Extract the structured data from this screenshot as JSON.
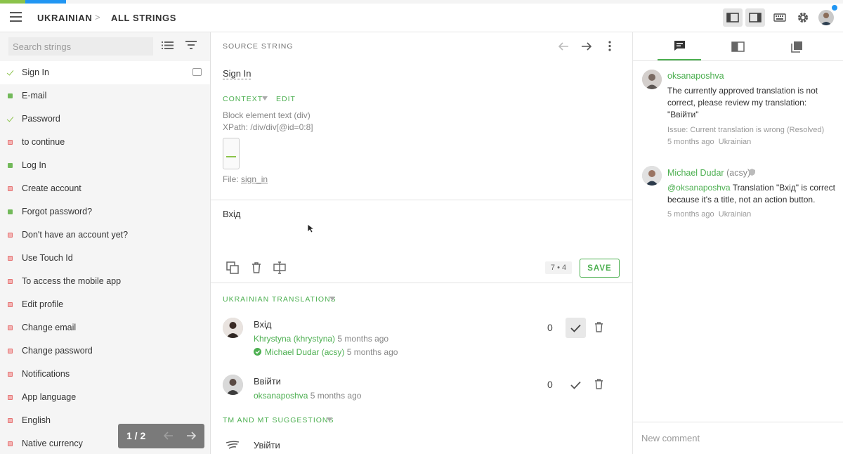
{
  "header": {
    "breadcrumb_language": "UKRAINIAN",
    "breadcrumb_sep": ">",
    "breadcrumb_view": "ALL STRINGS"
  },
  "colors": {
    "accent": "#4caf50",
    "approved": "#8bc34a",
    "untranslated": "#e57373",
    "notification": "#2196f3"
  },
  "sidebar": {
    "search_placeholder": "Search strings",
    "items": [
      {
        "label": "Sign In",
        "status": "approved"
      },
      {
        "label": "E-mail",
        "status": "translated"
      },
      {
        "label": "Password",
        "status": "approved"
      },
      {
        "label": "to continue",
        "status": "untranslated"
      },
      {
        "label": "Log In",
        "status": "translated"
      },
      {
        "label": "Create account",
        "status": "untranslated"
      },
      {
        "label": "Forgot password?",
        "status": "translated"
      },
      {
        "label": "Don't have an account yet?",
        "status": "untranslated"
      },
      {
        "label": "Use Touch Id",
        "status": "untranslated"
      },
      {
        "label": "To access the mobile app",
        "status": "untranslated"
      },
      {
        "label": "Edit profile",
        "status": "untranslated"
      },
      {
        "label": "Change email",
        "status": "untranslated"
      },
      {
        "label": "Change password",
        "status": "untranslated"
      },
      {
        "label": "Notifications",
        "status": "untranslated"
      },
      {
        "label": "App language",
        "status": "untranslated"
      },
      {
        "label": "English",
        "status": "untranslated"
      },
      {
        "label": "Native currency",
        "status": "untranslated"
      }
    ],
    "pager_text": "1 / 2"
  },
  "source": {
    "section_label": "SOURCE STRING",
    "text": "Sign In",
    "context_label": "CONTEXT",
    "edit_label": "EDIT",
    "context_line1": "Block element text (div)",
    "context_line2": "XPath: /div/div[@id=0:8]",
    "file_prefix": "File: ",
    "file_name": "sign_in"
  },
  "editor": {
    "value": "Вхід",
    "counter": "7 • 4",
    "save_label": "SAVE"
  },
  "translations": {
    "section_label": "UKRAINIAN TRANSLATIONS",
    "items": [
      {
        "text": "Вхід",
        "author": "Khrystyna (khrystyna)",
        "time": "5 months ago",
        "votes": "0",
        "approver": "Michael Dudar (acsy)",
        "approver_time": "5 months ago"
      },
      {
        "text": "Ввійти",
        "author": "oksanaposhva",
        "time": "5 months ago",
        "votes": "0"
      }
    ]
  },
  "suggestions": {
    "section_label": "TM AND MT SUGGESTIONS",
    "first_text": "Увійти"
  },
  "comments": {
    "items": [
      {
        "author": "oksanaposhva",
        "body": "The currently approved translation is not correct, please review my translation: \"Ввійти\"",
        "issue": "Issue: Current translation is wrong (Resolved)",
        "time": "5 months ago",
        "lang": "Ukrainian"
      },
      {
        "author": "Michael Dudar",
        "nick": "(acsy)",
        "mention": "@oksanaposhva",
        "body": " Translation \"Вхід\" is correct because it's a title, not an action button.",
        "time": "5 months ago",
        "lang": "Ukrainian"
      }
    ],
    "new_comment_placeholder": "New comment"
  }
}
